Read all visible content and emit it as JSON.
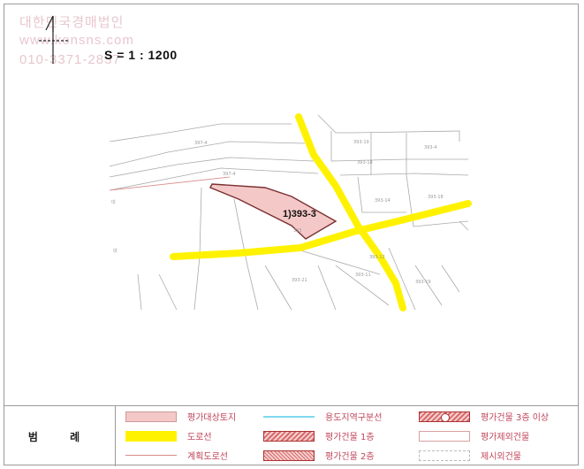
{
  "watermark": {
    "line1": "대한민국경매법인",
    "line2": "www.konsns.com",
    "line3": "010-3371-2837"
  },
  "scale_text": "S = 1 : 1200",
  "north_arrow": "north-arrow-icon",
  "parcel_label": "1)393-3",
  "colors": {
    "target_parcel_fill": "#f5c8c8",
    "road_line": "#fff200",
    "zoning_boundary": "#7fd8ef",
    "planned_road": "#d98a8a",
    "legend_text": "#c0455a"
  },
  "legend": {
    "title": "범 례",
    "items": [
      {
        "key": "target",
        "label": "평가대상토지"
      },
      {
        "key": "zoning",
        "label": "용도지역구분선"
      },
      {
        "key": "bldg3",
        "label": "평가건물 3층 이상"
      },
      {
        "key": "road",
        "label": "도로선"
      },
      {
        "key": "bldg1",
        "label": "평가건물 1층"
      },
      {
        "key": "excluded",
        "label": "평가제외건물"
      },
      {
        "key": "planned",
        "label": "계획도로선"
      },
      {
        "key": "bldg2",
        "label": "평가건물 2층"
      },
      {
        "key": "unlisted",
        "label": "제시외건물"
      }
    ]
  }
}
